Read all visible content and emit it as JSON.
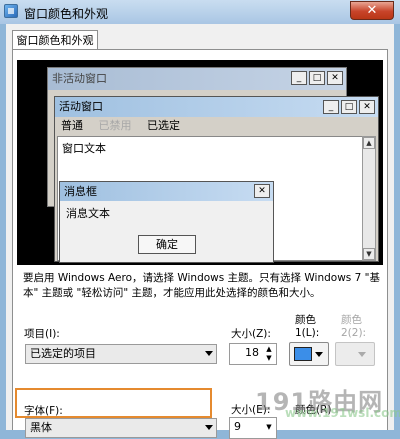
{
  "window": {
    "title": "窗口颜色和外观"
  },
  "tab": {
    "label": "窗口颜色和外观"
  },
  "preview": {
    "inactive_title": "非活动窗口",
    "active_title": "活动窗口",
    "menu": {
      "normal": "普通",
      "disabled": "已禁用",
      "selected": "已选定"
    },
    "window_text": "窗口文本",
    "message_title": "消息框",
    "message_text": "消息文本",
    "ok_label": "确定",
    "caption_buttons": {
      "minimize": "_",
      "maximize": "□",
      "close": "✕"
    }
  },
  "hint": "要启用 Windows Aero，请选择 Windows 主题。只有选择 Windows 7 \"基本\" 主题或 \"轻松访问\" 主题，才能应用此处选择的颜色和大小。",
  "item": {
    "label": "项目(I):",
    "value": "已选定的项目",
    "size_label": "大小(Z):",
    "size_value": "18",
    "color1_label": "颜色\n1(L):",
    "color1_hex": "#3b8ee8",
    "color2_label": "颜色\n2(2):"
  },
  "font": {
    "label": "字体(F):",
    "value": "黑体",
    "size_label": "大小(E):",
    "size_value": "9",
    "color_label": "颜色(R)"
  },
  "watermark": {
    "main": "191路由网",
    "sub": "www.191wsl.com"
  }
}
